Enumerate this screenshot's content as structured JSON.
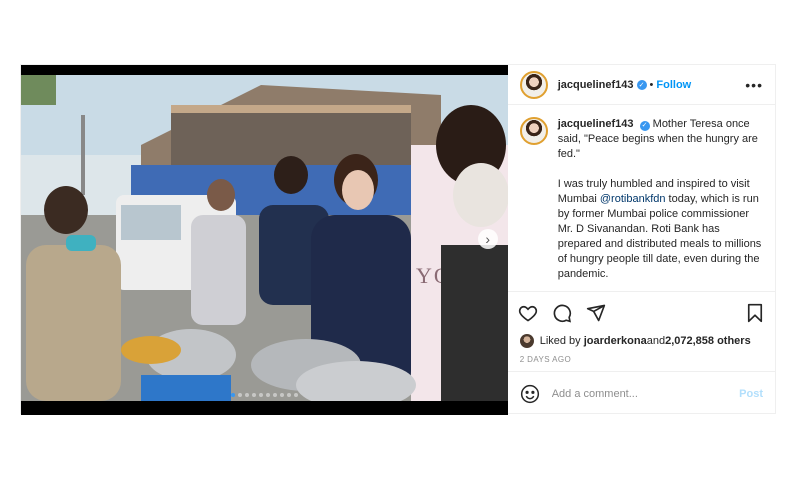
{
  "post": {
    "username": "jacquelinef143",
    "follow_label": "Follow",
    "separator": "•",
    "more_label": "•••",
    "photo_banner_text": "YOLO",
    "caption": {
      "username": "jacquelinef143",
      "text_part1": "Mother Teresa once said, \"Peace begins when the hungry are fed.\"\n\nI was truly humbled and inspired to visit Mumbai ",
      "mention": "@rotibankfdn",
      "text_part2": " today, which is run by former Mumbai police commissioner Mr. D Sivanandan. Roti Bank has prepared and distributed meals to millions of hungry people till date, even during the pandemic."
    },
    "likes": {
      "prefix": "Liked by ",
      "user": "joarderkona",
      "middle": " and ",
      "count": "2,072,858 others"
    },
    "timestamp": "2 DAYS AGO",
    "comment": {
      "placeholder": "Add a comment...",
      "post_label": "Post"
    },
    "carousel": {
      "total": 10,
      "current": 1
    }
  },
  "colors": {
    "accent": "#0095f6",
    "verified": "#3897f0",
    "muted": "#8e8e8e"
  },
  "icons": [
    "verified-badge-icon",
    "heart-icon",
    "comment-icon",
    "share-icon",
    "bookmark-icon",
    "emoji-icon",
    "chevron-right-icon"
  ]
}
